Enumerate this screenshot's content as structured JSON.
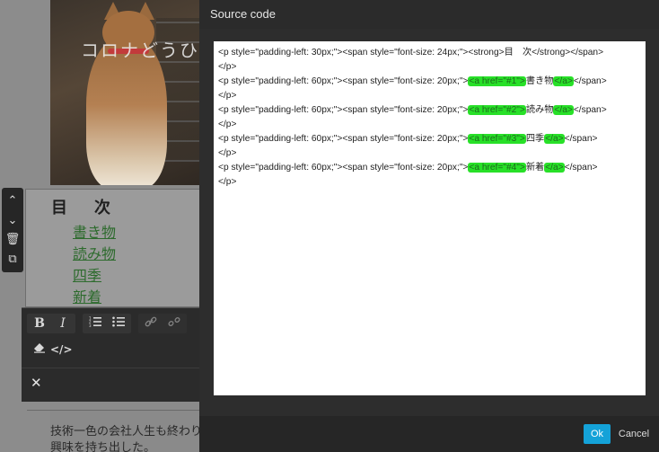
{
  "editor": {
    "photo_caption": "コロナどうひろ",
    "toc": {
      "heading": "目　次",
      "links": [
        "書き物",
        "読み物",
        "四季",
        "新着"
      ]
    },
    "side_tools": [
      "⌃",
      "⌄",
      "🗑",
      "⧉"
    ],
    "toolbar": {
      "bold": "B",
      "italic": "I",
      "close": "✕"
    },
    "body_text_line1": "技術一色の会社人生も終わり",
    "body_text_line2": "興味を持ち出した。"
  },
  "dialog": {
    "title": "Source code",
    "code_lines": [
      {
        "pre": "<p style=\"padding-left: 30px;\"><span style=\"font-size: 24px;\"><strong>目　次</strong></span>",
        "hl_open": "",
        "text": "",
        "hl_close": "",
        "post": ""
      },
      {
        "pre": "</p>",
        "hl_open": "",
        "text": "",
        "hl_close": "",
        "post": ""
      },
      {
        "pre": "<p style=\"padding-left: 60px;\"><span style=\"font-size: 20px;\">",
        "hl_open": "<a href=\"#1\">",
        "text": "書き物",
        "hl_close": "</a>",
        "post": "</span>"
      },
      {
        "pre": "</p>",
        "hl_open": "",
        "text": "",
        "hl_close": "",
        "post": ""
      },
      {
        "pre": "<p style=\"padding-left: 60px;\"><span style=\"font-size: 20px;\">",
        "hl_open": "<a href=\"#2\">",
        "text": "読み物",
        "hl_close": "</a>",
        "post": "</span>"
      },
      {
        "pre": "</p>",
        "hl_open": "",
        "text": "",
        "hl_close": "",
        "post": ""
      },
      {
        "pre": "<p style=\"padding-left: 60px;\"><span style=\"font-size: 20px;\">",
        "hl_open": "<a href=\"#3\">",
        "text": "四季",
        "hl_close": "</a>",
        "post": "</span>"
      },
      {
        "pre": "</p>",
        "hl_open": "",
        "text": "",
        "hl_close": "",
        "post": ""
      },
      {
        "pre": "<p style=\"padding-left: 60px;\"><span style=\"font-size: 20px;\">",
        "hl_open": "<a href=\"#4\">",
        "text": "新着",
        "hl_close": "</a>",
        "post": "</span>"
      },
      {
        "pre": "</p>",
        "hl_open": "",
        "text": "",
        "hl_close": "",
        "post": ""
      }
    ],
    "ok_label": "Ok",
    "cancel_label": "Cancel"
  },
  "colors": {
    "highlight": "#28e028",
    "ok_button": "#14a2d8",
    "dialog_bg": "#2d2d2d"
  }
}
